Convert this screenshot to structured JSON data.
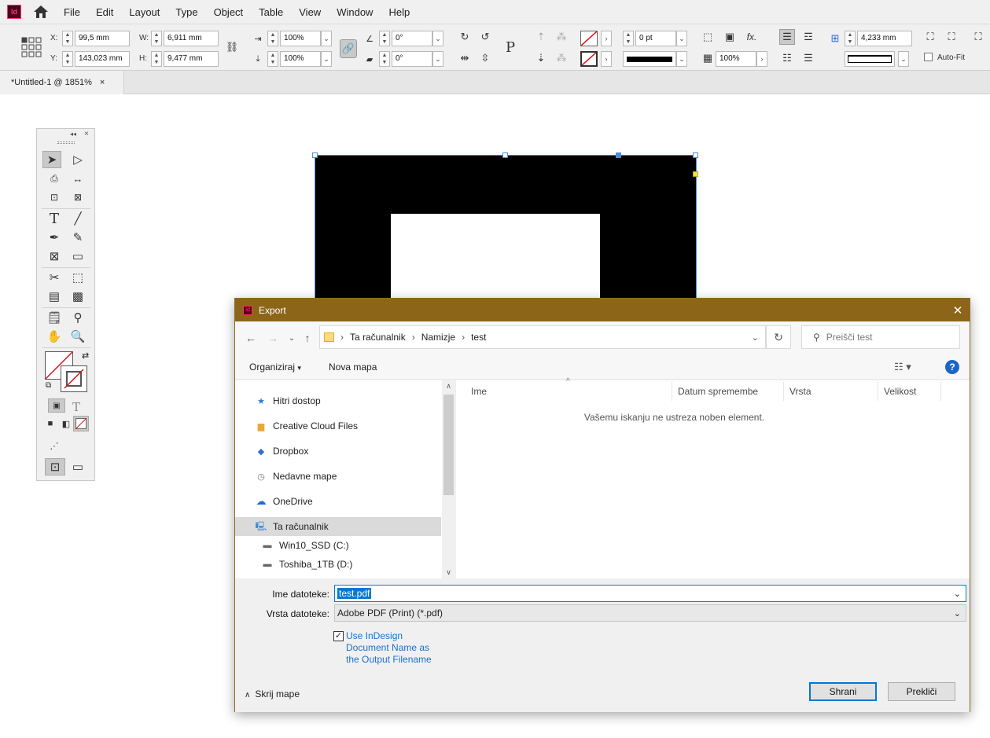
{
  "app": {
    "logo_text": "Id",
    "menu": [
      "File",
      "Edit",
      "Layout",
      "Type",
      "Object",
      "Table",
      "View",
      "Window",
      "Help"
    ]
  },
  "control": {
    "x_label": "X:",
    "x_value": "99,5 mm",
    "y_label": "Y:",
    "y_value": "143,023 mm",
    "w_label": "W:",
    "w_value": "6,911 mm",
    "h_label": "H:",
    "h_value": "9,477 mm",
    "scale_x": "100%",
    "scale_y": "100%",
    "rotate": "0°",
    "shear": "0°",
    "stroke_weight": "0 pt",
    "opacity": "100%",
    "gutter": "4,233 mm",
    "autofit_label": "Auto-Fit"
  },
  "tab": {
    "title": "*Untitled-1 @ 1851%",
    "close": "×"
  },
  "dialog": {
    "title": "Export",
    "close": "✕",
    "breadcrumb": [
      "Ta računalnik",
      "Namizje",
      "test"
    ],
    "search_placeholder": "Preišči test",
    "organize": "Organiziraj",
    "new_folder": "Nova mapa",
    "help": "?",
    "nav_items": [
      {
        "label": "Hitri dostop",
        "icon": "star-icon"
      },
      {
        "label": "Creative Cloud Files",
        "icon": "creative-cloud-folder-icon"
      },
      {
        "label": "Dropbox",
        "icon": "dropbox-icon"
      },
      {
        "label": "Nedavne mape",
        "icon": "recent-folders-icon"
      },
      {
        "label": "OneDrive",
        "icon": "onedrive-cloud-icon"
      },
      {
        "label": "Ta računalnik",
        "icon": "computer-icon"
      },
      {
        "label": "Win10_SSD (C:)",
        "icon": "drive-c-icon"
      },
      {
        "label": "Toshiba_1TB (D:)",
        "icon": "drive-d-icon"
      }
    ],
    "columns": [
      "Ime",
      "Datum spremembe",
      "Vrsta",
      "Velikost"
    ],
    "empty_message": "Vašemu iskanju ne ustreza noben element.",
    "filename_label": "Ime datoteke:",
    "filename_value": "test.pdf",
    "filetype_label": "Vrsta datoteke:",
    "filetype_value": "Adobe PDF (Print) (*.pdf)",
    "checkbox_label_1": "Use InDesign",
    "checkbox_label_2": "Document Name as",
    "checkbox_label_3": "the Output Filename",
    "checkbox_checked": true,
    "hide_folders": "Skrij mape",
    "save": "Shrani",
    "cancel": "Prekliči"
  }
}
